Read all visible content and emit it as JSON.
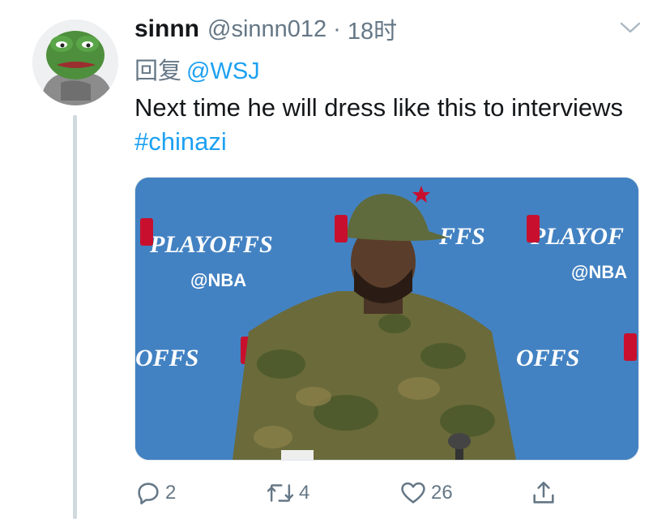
{
  "tweet": {
    "display_name": "sinnn",
    "handle": "@sinnn012",
    "separator": "·",
    "time": "18时",
    "reply_prefix": "回复",
    "reply_to": "@WSJ",
    "text_main": "Next time he will dress like this to interviews",
    "hashtag": "#chinazi",
    "image": {
      "backdrop_text_1": "PLAYOFFS",
      "backdrop_text_2": "@NBA",
      "backdrop_text_3": "FFS",
      "backdrop_text_4": "OFFS",
      "backdrop_text_5": "PLAYOF"
    }
  },
  "actions": {
    "reply_count": "2",
    "retweet_count": "4",
    "like_count": "26"
  },
  "colors": {
    "accent": "#1da1f2",
    "text": "#14171a",
    "secondary": "#657786",
    "backdrop_blue": "#3f7fc0"
  },
  "icons": [
    "chevron-down-icon",
    "reply-icon",
    "retweet-icon",
    "heart-icon",
    "share-icon"
  ]
}
